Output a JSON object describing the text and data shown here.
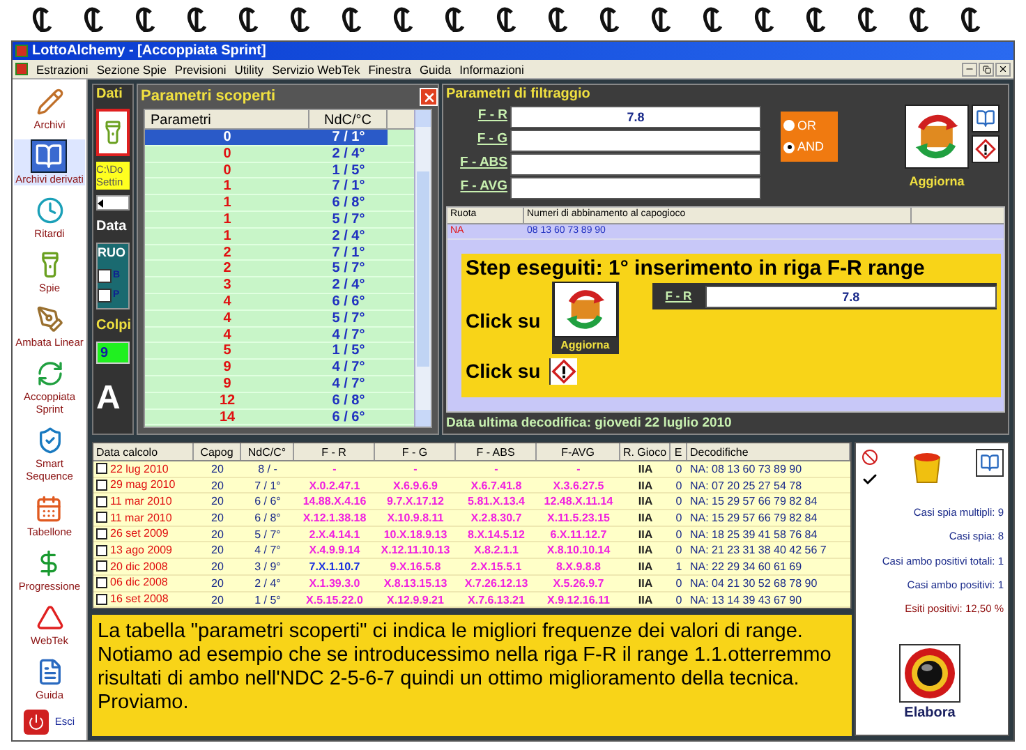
{
  "window": {
    "title": "LottoAlchemy - [Accoppiata Sprint]"
  },
  "menu": [
    "Estrazioni",
    "Sezione Spie",
    "Previsioni",
    "Utility",
    "Servizio WebTek",
    "Finestra",
    "Guida",
    "Informazioni"
  ],
  "sidebar": [
    {
      "label": "Archivi",
      "selected": false
    },
    {
      "label": "Archivi derivati",
      "selected": true
    },
    {
      "label": "Ritardi",
      "selected": false
    },
    {
      "label": "Spie",
      "selected": false
    },
    {
      "label": "Ambata Linear",
      "selected": false
    },
    {
      "label": "Accoppiata Sprint",
      "selected": false
    },
    {
      "label": "Smart Sequence",
      "selected": false
    },
    {
      "label": "Tabellone",
      "selected": false
    },
    {
      "label": "Progressione",
      "selected": false
    },
    {
      "label": "WebTek",
      "selected": false
    },
    {
      "label": "Guida",
      "selected": false
    },
    {
      "label": "Esci",
      "selected": false
    }
  ],
  "dati_panel": {
    "title": "Dati",
    "path": [
      "C:\\Do",
      "Settin"
    ],
    "date_label": "Data",
    "group_title": "RUO",
    "checkboxes": [
      {
        "label": "B",
        "checked": false
      },
      {
        "label": "P",
        "checked": false
      }
    ],
    "colpi_label": "Colpi",
    "colpi_value": "9",
    "heading": "A"
  },
  "parametri_scoperti": {
    "title": "Parametri scoperti",
    "columns": [
      "Parametri",
      "NdC/°C"
    ],
    "rows": [
      {
        "parametro": "0",
        "ndc": "7 / 1°",
        "selected": true
      },
      {
        "parametro": "0",
        "ndc": "2 / 4°",
        "selected": false
      },
      {
        "parametro": "0",
        "ndc": "1 / 5°",
        "selected": false
      },
      {
        "parametro": "1",
        "ndc": "7 / 1°",
        "selected": false
      },
      {
        "parametro": "1",
        "ndc": "6 / 8°",
        "selected": false
      },
      {
        "parametro": "1",
        "ndc": "5 / 7°",
        "selected": false
      },
      {
        "parametro": "1",
        "ndc": "2 / 4°",
        "selected": false
      },
      {
        "parametro": "2",
        "ndc": "7 / 1°",
        "selected": false
      },
      {
        "parametro": "2",
        "ndc": "5 / 7°",
        "selected": false
      },
      {
        "parametro": "3",
        "ndc": "2 / 4°",
        "selected": false
      },
      {
        "parametro": "4",
        "ndc": "6 / 6°",
        "selected": false
      },
      {
        "parametro": "4",
        "ndc": "5 / 7°",
        "selected": false
      },
      {
        "parametro": "4",
        "ndc": "4 / 7°",
        "selected": false
      },
      {
        "parametro": "5",
        "ndc": "1 / 5°",
        "selected": false
      },
      {
        "parametro": "9",
        "ndc": "4 / 7°",
        "selected": false
      },
      {
        "parametro": "9",
        "ndc": "4 / 7°",
        "selected": false
      },
      {
        "parametro": "12",
        "ndc": "6 / 8°",
        "selected": false
      },
      {
        "parametro": "14",
        "ndc": "6 / 6°",
        "selected": false
      }
    ]
  },
  "filtraggio": {
    "title": "Parametri di filtraggio",
    "fields": [
      {
        "label": "F - R",
        "value": "7.8"
      },
      {
        "label": "F - G"
      },
      {
        "label": "F - ABS"
      },
      {
        "label": "F - AVG"
      }
    ],
    "logic": [
      {
        "label": "OR",
        "selected": false
      },
      {
        "label": "AND",
        "selected": true
      }
    ],
    "aggiorna": "Aggiorna",
    "grid": {
      "columns": [
        "Ruota",
        "Numeri di abbinamento al capogioco"
      ],
      "rows": [
        {
          "ruota": "NA",
          "numeri": "08 13 60 73 89 90"
        }
      ]
    },
    "step": {
      "title": "Step eseguiti: 1° inserimento in riga F-R range",
      "click_aggiorna": "Click su",
      "button_label": "Aggiorna",
      "field_label": "F - R",
      "field_value": "7.8",
      "click_warning": "Click su"
    },
    "footer": "Data ultima decodifica: giovedi 22 luglio 2010"
  },
  "results": {
    "columns": [
      "Data calcolo",
      "Capog",
      "NdC/C°",
      "F - R",
      "F - G",
      "F - ABS",
      "F-AVG",
      "R. Gioco",
      "E",
      "Decodifiche"
    ],
    "rows": [
      {
        "checked": false,
        "match": false,
        "cells": [
          "22 lug 2010",
          "20",
          "8 / -",
          "-",
          "-",
          "-",
          "-",
          "IIA",
          "0",
          "NA: 08 13 60 73 89 90"
        ]
      },
      {
        "checked": false,
        "match": false,
        "cells": [
          "29 mag 2010",
          "20",
          "7 / 1°",
          "X.0.2.47.1",
          "X.6.9.6.9",
          "X.6.7.41.8",
          "X.3.6.27.5",
          "IIA",
          "0",
          "NA: 07 20 25 27 54 78"
        ]
      },
      {
        "checked": false,
        "match": false,
        "cells": [
          "11 mar 2010",
          "20",
          "6 / 6°",
          "14.88.X.4.16",
          "9.7.X.17.12",
          "5.81.X.13.4",
          "12.48.X.11.14",
          "IIA",
          "0",
          "NA: 15 29 57 66 79 82 84"
        ]
      },
      {
        "checked": false,
        "match": false,
        "cells": [
          "11 mar 2010",
          "20",
          "6 / 8°",
          "X.12.1.38.18",
          "X.10.9.8.11",
          "X.2.8.30.7",
          "X.11.5.23.15",
          "IIA",
          "0",
          "NA: 15 29 57 66 79 82 84"
        ]
      },
      {
        "checked": false,
        "match": false,
        "cells": [
          "26 set 2009",
          "20",
          "5 / 7°",
          "2.X.4.14.1",
          "10.X.18.9.13",
          "8.X.14.5.12",
          "6.X.11.12.7",
          "IIA",
          "0",
          "NA: 18 25 39 41 58 76 84"
        ]
      },
      {
        "checked": false,
        "match": false,
        "cells": [
          "13 ago 2009",
          "20",
          "4 / 7°",
          "X.4.9.9.14",
          "X.12.11.10.13",
          "X.8.2.1.1",
          "X.8.10.10.14",
          "IIA",
          "0",
          "NA: 21 23 31 38 40 42 56 7"
        ]
      },
      {
        "checked": false,
        "match": true,
        "cells": [
          "20 dic 2008",
          "20",
          "3 / 9°",
          "7.X.1.10.7",
          "9.X.16.5.8",
          "2.X.15.5.1",
          "8.X.9.8.8",
          "IIA",
          "1",
          "NA: 22 29 34 60 61 69"
        ]
      },
      {
        "checked": false,
        "match": false,
        "cells": [
          "06 dic 2008",
          "20",
          "2 / 4°",
          "X.1.39.3.0",
          "X.8.13.15.13",
          "X.7.26.12.13",
          "X.5.26.9.7",
          "IIA",
          "0",
          "NA: 04 21 30 52 68 78 90"
        ]
      },
      {
        "checked": false,
        "match": false,
        "cells": [
          "16 set 2008",
          "20",
          "1 / 5°",
          "X.5.15.22.0",
          "X.12.9.9.21",
          "X.7.6.13.21",
          "X.9.12.16.11",
          "IIA",
          "0",
          "NA: 13 14 39 43 67 90"
        ]
      }
    ]
  },
  "note": "La tabella \"parametri scoperti\" ci indica le migliori frequenze dei valori di range. Notiamo ad esempio che se introducessimo nella riga F-R il range 1.1.otterremmo risultati di ambo nell'NDC 2-5-6-7 quindi un ottimo miglioramento della tecnica. Proviamo.",
  "stats": [
    {
      "text": "Casi spia multipli: 9",
      "kind": "normal"
    },
    {
      "text": "Casi spia: 8",
      "kind": "normal"
    },
    {
      "text": "Casi ambo positivi totali: 1",
      "kind": "normal"
    },
    {
      "text": "Casi ambo positivi: 1",
      "kind": "normal"
    },
    {
      "text": "Esiti positivi: 12,50 %",
      "kind": "result"
    }
  ],
  "elabora": "Elabora"
}
